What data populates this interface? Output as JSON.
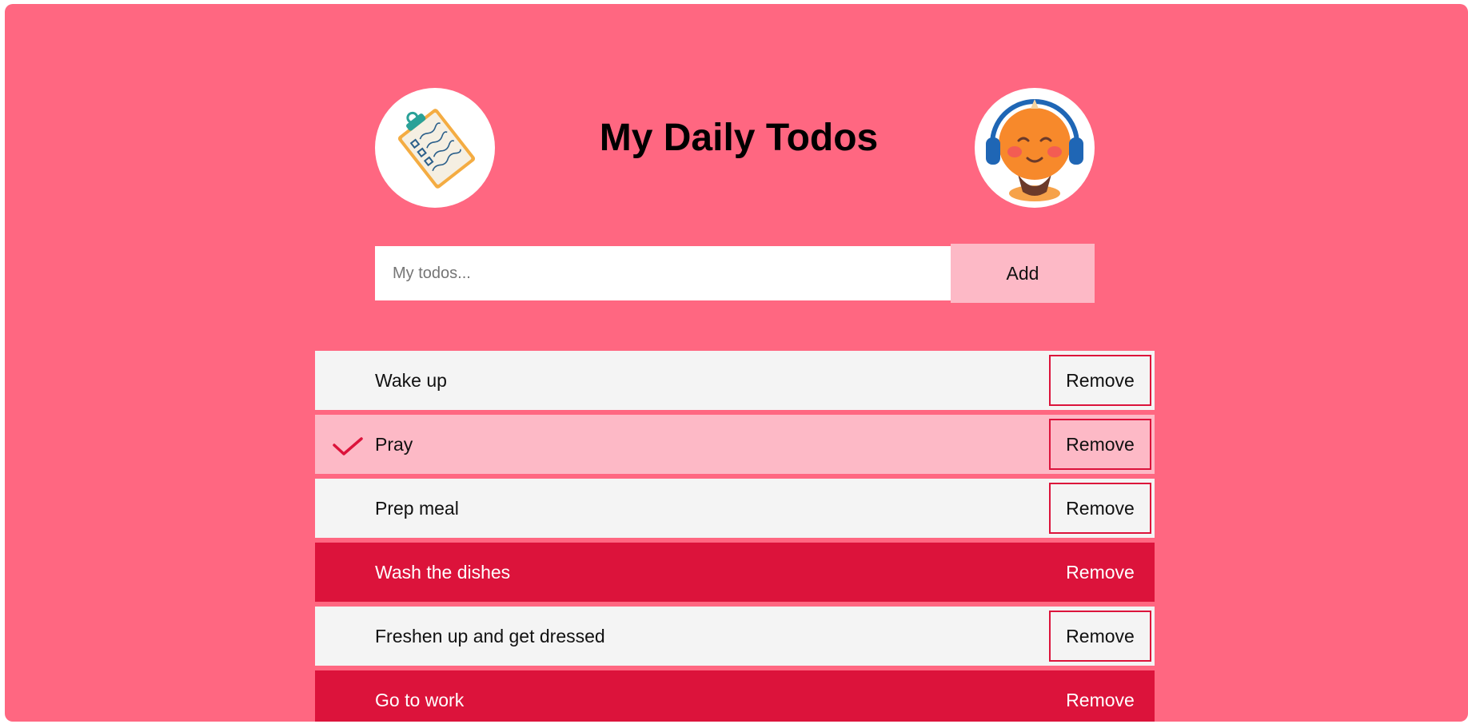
{
  "header": {
    "title": "My Daily Todos",
    "left_image_icon": "clipboard-checklist-icon",
    "right_image_icon": "orange-character-headphones-icon"
  },
  "form": {
    "placeholder": "My todos...",
    "value": "",
    "add_label": "Add"
  },
  "todos": [
    {
      "text": "Wake up",
      "status": "normal",
      "remove_label": "Remove"
    },
    {
      "text": "Pray",
      "status": "checked",
      "remove_label": "Remove"
    },
    {
      "text": "Prep meal",
      "status": "normal",
      "remove_label": "Remove"
    },
    {
      "text": "Wash the dishes",
      "status": "highlighted",
      "remove_label": "Remove"
    },
    {
      "text": "Freshen up and get dressed",
      "status": "normal",
      "remove_label": "Remove"
    },
    {
      "text": "Go to work",
      "status": "highlighted",
      "remove_label": "Remove"
    }
  ],
  "colors": {
    "background": "#ff6781",
    "item_default": "#f4f4f4",
    "item_checked": "#fdb9c6",
    "item_highlight": "#dc133b",
    "accent_border": "#dc133b",
    "add_button": "#fdb9c6"
  }
}
